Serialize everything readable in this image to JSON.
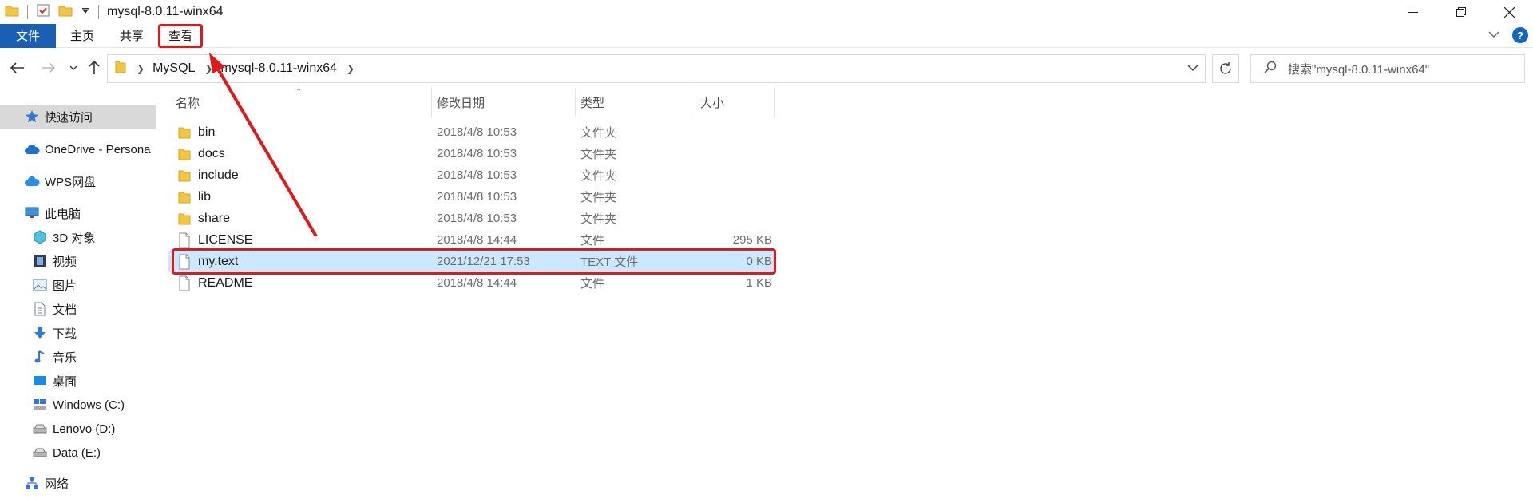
{
  "window": {
    "title": "mysql-8.0.11-winx64",
    "controls": [
      "minimize",
      "maximize",
      "close"
    ]
  },
  "ribbon": {
    "tabs": [
      {
        "label": "文件"
      },
      {
        "label": "主页"
      },
      {
        "label": "共享"
      },
      {
        "label": "查看"
      }
    ],
    "help_label": "?"
  },
  "address": {
    "breadcrumb": [
      "MySQL",
      "mysql-8.0.11-winx64"
    ],
    "search_placeholder": "搜索\"mysql-8.0.11-winx64\""
  },
  "sidebar": {
    "items": [
      {
        "label": "快速访问",
        "icon": "star-icon"
      },
      {
        "label": "OneDrive - Persona",
        "icon": "cloud-icon"
      },
      {
        "label": "WPS网盘",
        "icon": "cloud-icon"
      },
      {
        "label": "此电脑",
        "icon": "computer-icon"
      },
      {
        "label": "3D 对象",
        "icon": "cube-icon"
      },
      {
        "label": "视频",
        "icon": "film-icon"
      },
      {
        "label": "图片",
        "icon": "picture-icon"
      },
      {
        "label": "文档",
        "icon": "document-icon"
      },
      {
        "label": "下载",
        "icon": "download-icon"
      },
      {
        "label": "音乐",
        "icon": "music-icon"
      },
      {
        "label": "桌面",
        "icon": "desktop-icon"
      },
      {
        "label": "Windows (C:)",
        "icon": "drive-icon"
      },
      {
        "label": "Lenovo (D:)",
        "icon": "drive-icon"
      },
      {
        "label": "Data (E:)",
        "icon": "drive-icon"
      },
      {
        "label": "网络",
        "icon": "network-icon"
      }
    ]
  },
  "columns": {
    "name": "名称",
    "modified": "修改日期",
    "type": "类型",
    "size": "大小"
  },
  "files": [
    {
      "name": "bin",
      "modified": "2018/4/8 10:53",
      "type": "文件夹",
      "size": "",
      "icon": "folder-icon"
    },
    {
      "name": "docs",
      "modified": "2018/4/8 10:53",
      "type": "文件夹",
      "size": "",
      "icon": "folder-icon"
    },
    {
      "name": "include",
      "modified": "2018/4/8 10:53",
      "type": "文件夹",
      "size": "",
      "icon": "folder-icon"
    },
    {
      "name": "lib",
      "modified": "2018/4/8 10:53",
      "type": "文件夹",
      "size": "",
      "icon": "folder-icon"
    },
    {
      "name": "share",
      "modified": "2018/4/8 10:53",
      "type": "文件夹",
      "size": "",
      "icon": "folder-icon"
    },
    {
      "name": "LICENSE",
      "modified": "2018/4/8 14:44",
      "type": "文件",
      "size": "295 KB",
      "icon": "file-icon"
    },
    {
      "name": "my.text",
      "modified": "2021/12/21 17:53",
      "type": "TEXT 文件",
      "size": "0 KB",
      "icon": "file-icon",
      "selected": true
    },
    {
      "name": "README",
      "modified": "2018/4/8 14:44",
      "type": "文件",
      "size": "1 KB",
      "icon": "file-icon"
    }
  ],
  "colors": {
    "accent": "#1a5fb4",
    "selection": "#cce8ff",
    "annotation": "#e0191a"
  }
}
